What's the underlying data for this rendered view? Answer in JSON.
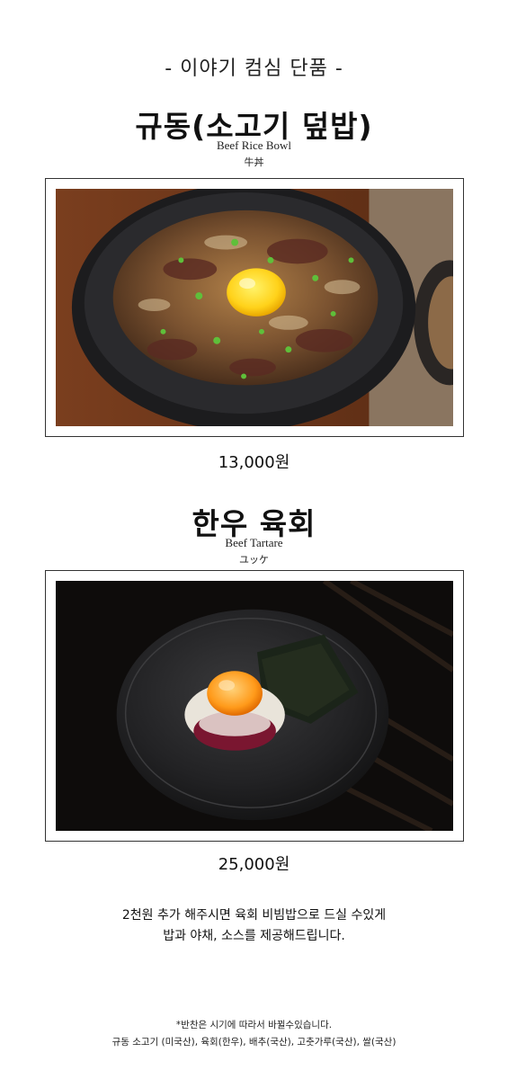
{
  "header": {
    "section_title": "- 이야기 컴심 단품 -"
  },
  "dishes": [
    {
      "name_ko": "규동(소고기 덮밥)",
      "name_en": "Beef Rice Bowl",
      "name_jp": "牛丼",
      "price": "13,000원",
      "photo_icon": "beef-rice-bowl-photo"
    },
    {
      "name_ko": "한우 육회",
      "name_en": "Beef Tartare",
      "name_jp": "ユッケ",
      "price": "25,000원",
      "photo_icon": "beef-tartare-photo"
    }
  ],
  "note": {
    "line1": "2천원 추가 해주시면 육회 비빔밥으로 드실 수있게",
    "line2": "밥과 야채, 소스를 제공해드립니다."
  },
  "footer": {
    "line1": "*반찬은 시기에 따라서 바뀔수있습니다.",
    "line2": "규동 소고기 (미국산), 육회(한우), 배추(국산), 고춧가루(국산), 쌀(국산)"
  },
  "colors": {
    "background": "#ffffff",
    "text": "#111111",
    "frame_border": "#333333"
  }
}
